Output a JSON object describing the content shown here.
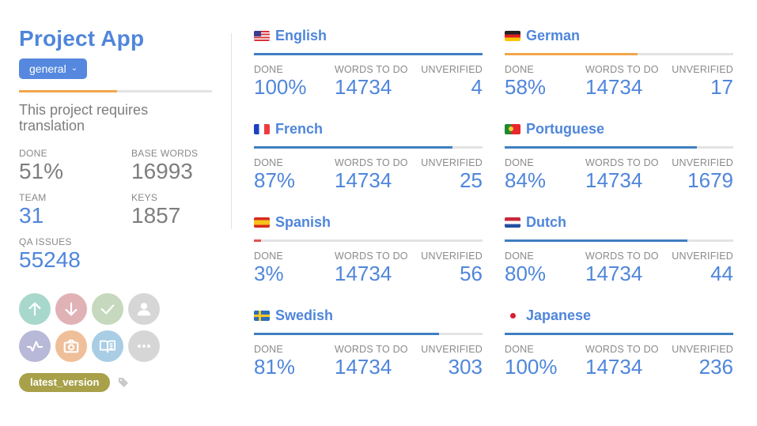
{
  "project": {
    "title": "Project App",
    "branch_label": "general",
    "progress_percent": 51,
    "progress_color": "#f2a64c",
    "description": "This project requires translation",
    "stats": {
      "done_label": "DONE",
      "done_value": "51%",
      "base_words_label": "BASE WORDS",
      "base_words_value": "16993",
      "team_label": "TEAM",
      "team_value": "31",
      "keys_label": "KEYS",
      "keys_value": "1857",
      "qa_label": "QA ISSUES",
      "qa_value": "55248"
    },
    "actions": [
      {
        "name": "upload-icon",
        "color": "#a8d8cc"
      },
      {
        "name": "download-icon",
        "color": "#e0b2b6"
      },
      {
        "name": "check-icon",
        "color": "#c6d8bd"
      },
      {
        "name": "user-icon",
        "color": "#d6d6d6"
      },
      {
        "name": "activity-icon",
        "color": "#b8b8d8"
      },
      {
        "name": "camera-icon",
        "color": "#efbf99"
      },
      {
        "name": "book-icon",
        "color": "#a8cde4"
      },
      {
        "name": "more-icon",
        "color": "#d6d6d6"
      }
    ],
    "tag_label": "latest_version"
  },
  "labels": {
    "done": "DONE",
    "words_to_do": "WORDS TO DO",
    "unverified": "UNVERIFIED"
  },
  "languages": [
    {
      "name": "English",
      "flag": "us",
      "done": "100%",
      "progress": 100,
      "bar_color": "#3f7fc0",
      "words_to_do": "14734",
      "unverified": "4"
    },
    {
      "name": "German",
      "flag": "de",
      "done": "58%",
      "progress": 58,
      "bar_color": "#f2a64c",
      "words_to_do": "14734",
      "unverified": "17"
    },
    {
      "name": "French",
      "flag": "fr",
      "done": "87%",
      "progress": 87,
      "bar_color": "#3f7fc0",
      "words_to_do": "14734",
      "unverified": "25"
    },
    {
      "name": "Portuguese",
      "flag": "pt",
      "done": "84%",
      "progress": 84,
      "bar_color": "#3f7fc0",
      "words_to_do": "14734",
      "unverified": "1679"
    },
    {
      "name": "Spanish",
      "flag": "es",
      "done": "3%",
      "progress": 3,
      "bar_color": "#e05252",
      "words_to_do": "14734",
      "unverified": "56"
    },
    {
      "name": "Dutch",
      "flag": "nl",
      "done": "80%",
      "progress": 80,
      "bar_color": "#3f7fc0",
      "words_to_do": "14734",
      "unverified": "44"
    },
    {
      "name": "Swedish",
      "flag": "se",
      "done": "81%",
      "progress": 81,
      "bar_color": "#3f7fc0",
      "words_to_do": "14734",
      "unverified": "303"
    },
    {
      "name": "Japanese",
      "flag": "jp",
      "done": "100%",
      "progress": 100,
      "bar_color": "#3f7fc0",
      "words_to_do": "14734",
      "unverified": "236"
    }
  ]
}
